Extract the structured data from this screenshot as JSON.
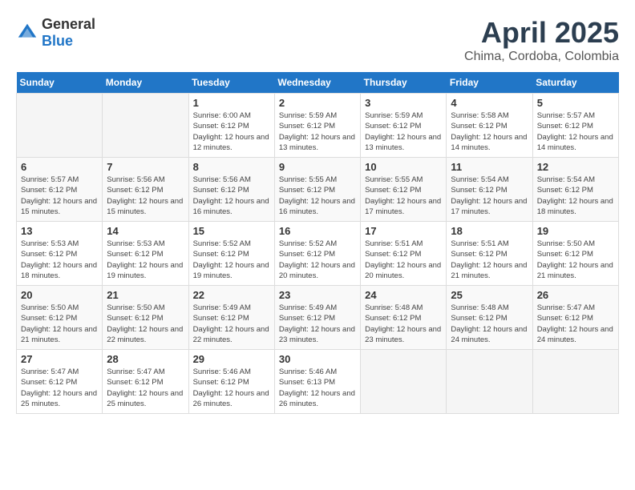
{
  "header": {
    "logo": {
      "general": "General",
      "blue": "Blue"
    },
    "title": "April 2025",
    "location": "Chima, Cordoba, Colombia"
  },
  "weekdays": [
    "Sunday",
    "Monday",
    "Tuesday",
    "Wednesday",
    "Thursday",
    "Friday",
    "Saturday"
  ],
  "weeks": [
    [
      {
        "day": null
      },
      {
        "day": null
      },
      {
        "day": "1",
        "sunrise": "Sunrise: 6:00 AM",
        "sunset": "Sunset: 6:12 PM",
        "daylight": "Daylight: 12 hours and 12 minutes."
      },
      {
        "day": "2",
        "sunrise": "Sunrise: 5:59 AM",
        "sunset": "Sunset: 6:12 PM",
        "daylight": "Daylight: 12 hours and 13 minutes."
      },
      {
        "day": "3",
        "sunrise": "Sunrise: 5:59 AM",
        "sunset": "Sunset: 6:12 PM",
        "daylight": "Daylight: 12 hours and 13 minutes."
      },
      {
        "day": "4",
        "sunrise": "Sunrise: 5:58 AM",
        "sunset": "Sunset: 6:12 PM",
        "daylight": "Daylight: 12 hours and 14 minutes."
      },
      {
        "day": "5",
        "sunrise": "Sunrise: 5:57 AM",
        "sunset": "Sunset: 6:12 PM",
        "daylight": "Daylight: 12 hours and 14 minutes."
      }
    ],
    [
      {
        "day": "6",
        "sunrise": "Sunrise: 5:57 AM",
        "sunset": "Sunset: 6:12 PM",
        "daylight": "Daylight: 12 hours and 15 minutes."
      },
      {
        "day": "7",
        "sunrise": "Sunrise: 5:56 AM",
        "sunset": "Sunset: 6:12 PM",
        "daylight": "Daylight: 12 hours and 15 minutes."
      },
      {
        "day": "8",
        "sunrise": "Sunrise: 5:56 AM",
        "sunset": "Sunset: 6:12 PM",
        "daylight": "Daylight: 12 hours and 16 minutes."
      },
      {
        "day": "9",
        "sunrise": "Sunrise: 5:55 AM",
        "sunset": "Sunset: 6:12 PM",
        "daylight": "Daylight: 12 hours and 16 minutes."
      },
      {
        "day": "10",
        "sunrise": "Sunrise: 5:55 AM",
        "sunset": "Sunset: 6:12 PM",
        "daylight": "Daylight: 12 hours and 17 minutes."
      },
      {
        "day": "11",
        "sunrise": "Sunrise: 5:54 AM",
        "sunset": "Sunset: 6:12 PM",
        "daylight": "Daylight: 12 hours and 17 minutes."
      },
      {
        "day": "12",
        "sunrise": "Sunrise: 5:54 AM",
        "sunset": "Sunset: 6:12 PM",
        "daylight": "Daylight: 12 hours and 18 minutes."
      }
    ],
    [
      {
        "day": "13",
        "sunrise": "Sunrise: 5:53 AM",
        "sunset": "Sunset: 6:12 PM",
        "daylight": "Daylight: 12 hours and 18 minutes."
      },
      {
        "day": "14",
        "sunrise": "Sunrise: 5:53 AM",
        "sunset": "Sunset: 6:12 PM",
        "daylight": "Daylight: 12 hours and 19 minutes."
      },
      {
        "day": "15",
        "sunrise": "Sunrise: 5:52 AM",
        "sunset": "Sunset: 6:12 PM",
        "daylight": "Daylight: 12 hours and 19 minutes."
      },
      {
        "day": "16",
        "sunrise": "Sunrise: 5:52 AM",
        "sunset": "Sunset: 6:12 PM",
        "daylight": "Daylight: 12 hours and 20 minutes."
      },
      {
        "day": "17",
        "sunrise": "Sunrise: 5:51 AM",
        "sunset": "Sunset: 6:12 PM",
        "daylight": "Daylight: 12 hours and 20 minutes."
      },
      {
        "day": "18",
        "sunrise": "Sunrise: 5:51 AM",
        "sunset": "Sunset: 6:12 PM",
        "daylight": "Daylight: 12 hours and 21 minutes."
      },
      {
        "day": "19",
        "sunrise": "Sunrise: 5:50 AM",
        "sunset": "Sunset: 6:12 PM",
        "daylight": "Daylight: 12 hours and 21 minutes."
      }
    ],
    [
      {
        "day": "20",
        "sunrise": "Sunrise: 5:50 AM",
        "sunset": "Sunset: 6:12 PM",
        "daylight": "Daylight: 12 hours and 21 minutes."
      },
      {
        "day": "21",
        "sunrise": "Sunrise: 5:50 AM",
        "sunset": "Sunset: 6:12 PM",
        "daylight": "Daylight: 12 hours and 22 minutes."
      },
      {
        "day": "22",
        "sunrise": "Sunrise: 5:49 AM",
        "sunset": "Sunset: 6:12 PM",
        "daylight": "Daylight: 12 hours and 22 minutes."
      },
      {
        "day": "23",
        "sunrise": "Sunrise: 5:49 AM",
        "sunset": "Sunset: 6:12 PM",
        "daylight": "Daylight: 12 hours and 23 minutes."
      },
      {
        "day": "24",
        "sunrise": "Sunrise: 5:48 AM",
        "sunset": "Sunset: 6:12 PM",
        "daylight": "Daylight: 12 hours and 23 minutes."
      },
      {
        "day": "25",
        "sunrise": "Sunrise: 5:48 AM",
        "sunset": "Sunset: 6:12 PM",
        "daylight": "Daylight: 12 hours and 24 minutes."
      },
      {
        "day": "26",
        "sunrise": "Sunrise: 5:47 AM",
        "sunset": "Sunset: 6:12 PM",
        "daylight": "Daylight: 12 hours and 24 minutes."
      }
    ],
    [
      {
        "day": "27",
        "sunrise": "Sunrise: 5:47 AM",
        "sunset": "Sunset: 6:12 PM",
        "daylight": "Daylight: 12 hours and 25 minutes."
      },
      {
        "day": "28",
        "sunrise": "Sunrise: 5:47 AM",
        "sunset": "Sunset: 6:12 PM",
        "daylight": "Daylight: 12 hours and 25 minutes."
      },
      {
        "day": "29",
        "sunrise": "Sunrise: 5:46 AM",
        "sunset": "Sunset: 6:12 PM",
        "daylight": "Daylight: 12 hours and 26 minutes."
      },
      {
        "day": "30",
        "sunrise": "Sunrise: 5:46 AM",
        "sunset": "Sunset: 6:13 PM",
        "daylight": "Daylight: 12 hours and 26 minutes."
      },
      {
        "day": null
      },
      {
        "day": null
      },
      {
        "day": null
      }
    ]
  ]
}
